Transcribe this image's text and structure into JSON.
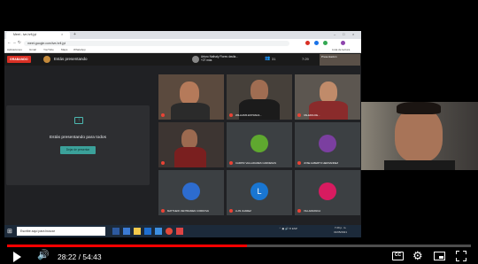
{
  "browser": {
    "tab_title": "Meet - ive-hrfi-jyt",
    "url": "meet.google.com/ive-hrfi-jyt",
    "bookmarks": [
      "Aplicaciones",
      "Gmail",
      "YouTube",
      "Maps",
      "WhatsApp"
    ],
    "other_bookmarks": "Lista de lectura"
  },
  "meet": {
    "recording_badge": "GRABANDO",
    "presenting_label": "Estás presentando",
    "speaker_name_line1": "Arturo Nathaly Flores davila...",
    "speaker_name_line2": "+27 más",
    "participant_count": "31",
    "clock": "7:29",
    "self_preview_label": "Presentación",
    "present_panel_text": "Estás presentando para todos",
    "stop_button": "Dejar de presentar",
    "tiles": [
      {
        "name": "",
        "kind": "video"
      },
      {
        "name": "WILLIAMS ESTRADA...",
        "kind": "video"
      },
      {
        "name": "VALERIA DE...",
        "kind": "video"
      },
      {
        "name": "",
        "kind": "video"
      },
      {
        "name": "CARPIO VALLADARES CARDENAS",
        "kind": "avatar",
        "initial": "",
        "color": "#5fa82f"
      },
      {
        "name": "JOSE ALBERTO HERNANDEZ",
        "kind": "avatar",
        "initial": "",
        "color": "#7b3fa0"
      },
      {
        "name": "MATTHEW VENTRAMEN CORDOVA",
        "kind": "avatar",
        "initial": "",
        "color": "#2d6ccf"
      },
      {
        "name": "LUIS JUAREZ",
        "kind": "avatar",
        "initial": "L",
        "color": "#1976d2"
      },
      {
        "name": "VILLAFRANCA",
        "kind": "avatar",
        "initial": "",
        "color": "#d81b60"
      }
    ],
    "meeting_details": "Detalles de la reunión",
    "captions_label": "Activar los subtítulos",
    "present_now_label": "Presentar ahora"
  },
  "taskbar": {
    "search_placeholder": "Escribe aquí para buscar",
    "time": "7:29 p. m.",
    "date": "31/05/2021"
  },
  "youtube": {
    "time_display": "28:22 / 54:43",
    "progress": 0.518,
    "colors": {
      "progress": "#ff0000"
    }
  }
}
